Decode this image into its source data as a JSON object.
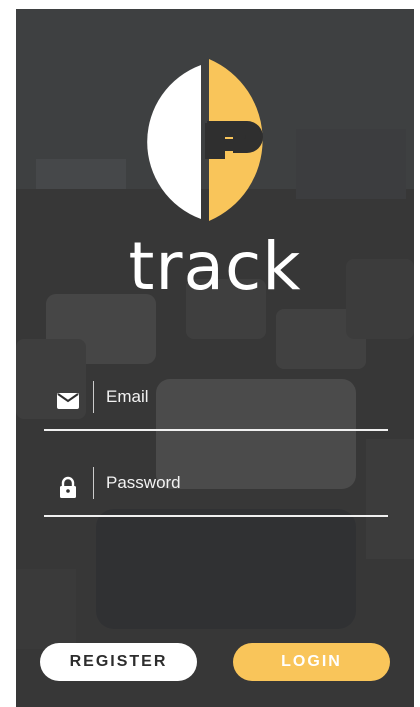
{
  "app": {
    "name": "track"
  },
  "colors": {
    "accent": "#f9c55a",
    "text": "#ffffff",
    "background_overlay": "#2b2b2b"
  },
  "form": {
    "email": {
      "placeholder": "Email",
      "icon": "envelope-icon"
    },
    "password": {
      "placeholder": "Password",
      "icon": "lock-icon"
    }
  },
  "buttons": {
    "register_label": "REGISTER",
    "login_label": "LOGIN"
  }
}
